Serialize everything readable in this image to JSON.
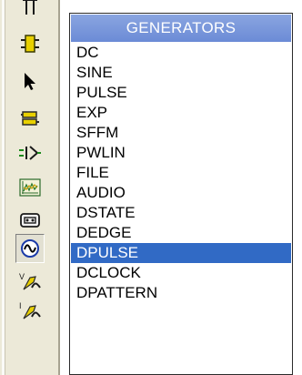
{
  "panel": {
    "title": "GENERATORS",
    "items": [
      "DC",
      "SINE",
      "PULSE",
      "EXP",
      "SFFM",
      "PWLIN",
      "FILE",
      "AUDIO",
      "DSTATE",
      "DEDGE",
      "DPULSE",
      "DCLOCK",
      "DPATTERN"
    ],
    "selected": "DPULSE"
  },
  "toolbar": {
    "tools": [
      {
        "icon": "junction-icon",
        "active": false
      },
      {
        "icon": "component-icon",
        "active": false
      },
      {
        "icon": "selection-arrow-icon",
        "active": false
      },
      {
        "icon": "bus-icon",
        "active": false
      },
      {
        "icon": "terminal-icon",
        "active": false
      },
      {
        "icon": "graph-icon",
        "active": false
      },
      {
        "icon": "tape-icon",
        "active": false
      },
      {
        "icon": "generator-icon",
        "active": true
      },
      {
        "icon": "voltage-probe-icon",
        "active": false
      },
      {
        "icon": "current-probe-icon",
        "active": false
      }
    ]
  },
  "colors": {
    "selection": "#316ac5",
    "title_bar": "#7a97dc",
    "toolbar": "#ece9d8"
  }
}
